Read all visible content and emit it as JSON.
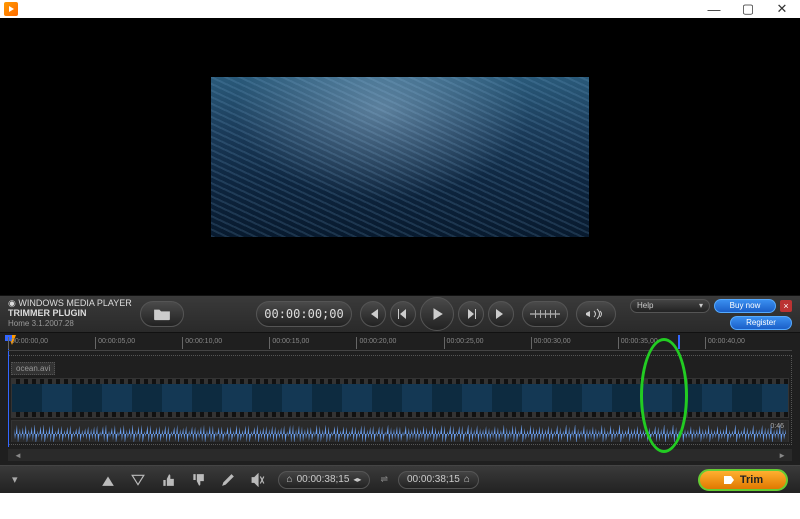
{
  "app": {
    "product": "WINDOWS MEDIA PLAYER",
    "plugin": "TRIMMER PLUGIN",
    "version": "Home 3.1.2007.28"
  },
  "toolbar": {
    "timecode": "00:00:00;00",
    "help": "Help",
    "buy": "Buy now",
    "register": "Register"
  },
  "ruler": [
    "00:00:00,00",
    "00:00:05,00",
    "00:00:10,00",
    "00:00:15,00",
    "00:00:20,00",
    "00:00:25,00",
    "00:00:30,00",
    "00:00:35,00",
    "00:00:40,00"
  ],
  "tracks": {
    "video_name": "ocean.avi",
    "duration": "0:46"
  },
  "bottom": {
    "tc1": "00:00:38;15",
    "tc2": "00:00:38;15",
    "trim": "Trim"
  }
}
